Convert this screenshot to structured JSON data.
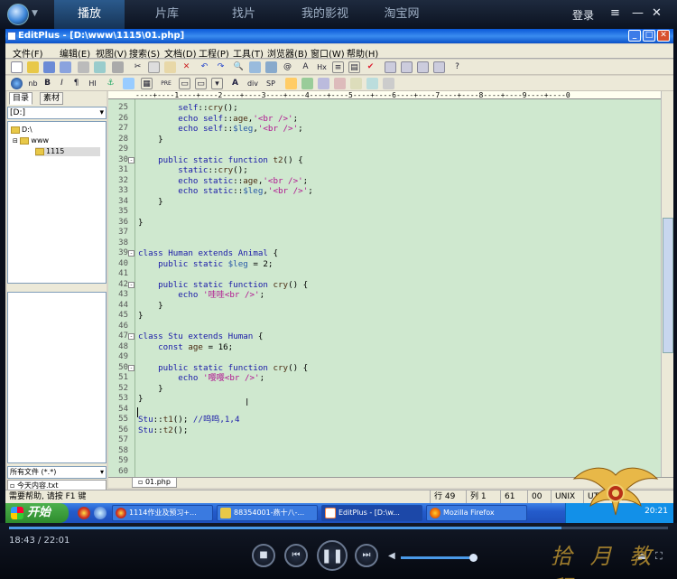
{
  "player": {
    "tabs": [
      "播放",
      "片库",
      "找片",
      "我的影视",
      "淘宝网"
    ],
    "login": "登录",
    "time": "18:43 / 22:01",
    "progress": 0.838,
    "volume": 0.9
  },
  "editplus": {
    "title": "EditPlus - [D:\\www\\1115\\01.php]",
    "menu": [
      "文件(F)",
      "编辑(E)",
      "视图(V)",
      "搜索(S)",
      "文档(D)",
      "工程(P)",
      "工具(T)",
      "浏览器(B)",
      "窗口(W)",
      "帮助(H)"
    ],
    "toolbar2": [
      "nb",
      "B",
      "I",
      "¶",
      "HI",
      "PRE",
      "A",
      "div",
      "SP"
    ],
    "left_tabs": [
      "目录",
      "素材"
    ],
    "drive": "[D:]",
    "tree": [
      "D:\\",
      "www",
      "1115"
    ],
    "filter": "所有文件 (*.*)",
    "bottom_file": "今天内容.txt",
    "doc_tab": "01.php",
    "ruler": "----+----1----+----2----+----3----+----4----+----5----+----6----+----7----+----8----+----9----+----0",
    "status": {
      "help": "需要帮助, 请按 F1 键",
      "row": "行 49",
      "col": "列 1",
      "num": "61",
      "ovr": "00",
      "fmt": "UNIX",
      "enc": "UTF-8"
    }
  },
  "code": [
    {
      "n": "25",
      "t": "        self::cry();"
    },
    {
      "n": "26",
      "t": "        echo self::age,'<br />';"
    },
    {
      "n": "27",
      "t": "        echo self::$leg,'<br />';"
    },
    {
      "n": "28",
      "t": "    }"
    },
    {
      "n": "29",
      "t": ""
    },
    {
      "n": "30",
      "t": "    public static function t2() {",
      "f": "⊟"
    },
    {
      "n": "31",
      "t": "        static::cry();"
    },
    {
      "n": "32",
      "t": "        echo static::age,'<br />';"
    },
    {
      "n": "33",
      "t": "        echo static::$leg,'<br />';"
    },
    {
      "n": "34",
      "t": "    }"
    },
    {
      "n": "35",
      "t": ""
    },
    {
      "n": "36",
      "t": "}"
    },
    {
      "n": "37",
      "t": ""
    },
    {
      "n": "38",
      "t": ""
    },
    {
      "n": "39",
      "t": "class Human extends Animal {",
      "f": "⊟"
    },
    {
      "n": "40",
      "t": "    public static $leg = 2;"
    },
    {
      "n": "41",
      "t": ""
    },
    {
      "n": "42",
      "t": "    public static function cry() {",
      "f": "⊟"
    },
    {
      "n": "43",
      "t": "        echo '哇哇<br />';"
    },
    {
      "n": "44",
      "t": "    }"
    },
    {
      "n": "45",
      "t": "}"
    },
    {
      "n": "46",
      "t": ""
    },
    {
      "n": "47",
      "t": "class Stu extends Human {",
      "f": "⊟"
    },
    {
      "n": "48",
      "t": "    const age = 16;"
    },
    {
      "n": "49",
      "t": ""
    },
    {
      "n": "50",
      "t": "    public static function cry() {",
      "f": "⊟"
    },
    {
      "n": "51",
      "t": "        echo '嘤嘤<br />';"
    },
    {
      "n": "52",
      "t": "    }"
    },
    {
      "n": "53",
      "t": "}"
    },
    {
      "n": "54",
      "t": ""
    },
    {
      "n": "55",
      "t": "Stu::t1(); //呜呜,1,4"
    },
    {
      "n": "56",
      "t": "Stu::t2();"
    },
    {
      "n": "57",
      "t": ""
    },
    {
      "n": "58",
      "t": ""
    },
    {
      "n": "59",
      "t": ""
    },
    {
      "n": "60",
      "t": ""
    }
  ],
  "taskbar": {
    "start": "开始",
    "items": [
      "1114作业及预习+...",
      "88354001-燕十八-...",
      "EditPlus - [D:\\w...",
      "Mozilla Firefox"
    ],
    "clock": "20:21"
  },
  "watermark": "拾 月 教 程",
  "colors": {
    "keyword": "#1a1aa8",
    "string": "#b0138f",
    "editor_bg": "#cfe8cf",
    "accent": "#2b5a8c"
  }
}
